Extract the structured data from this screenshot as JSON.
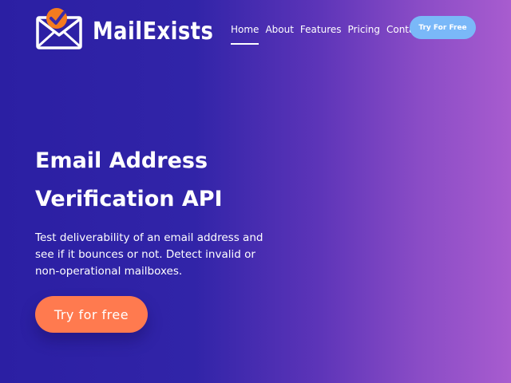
{
  "brand": {
    "name": "MailExists",
    "logo_icon": "envelope-check-icon"
  },
  "nav": {
    "items": [
      {
        "label": "Home",
        "active": true
      },
      {
        "label": "About",
        "active": false
      },
      {
        "label": "Features",
        "active": false
      },
      {
        "label": "Pricing",
        "active": false
      },
      {
        "label": "Contact",
        "active": false
      }
    ],
    "cta_label": "Try For Free"
  },
  "hero": {
    "title_line1": "Email Address",
    "title_line2": "Verification API",
    "description": "Test deliverability of an email address and see if it bounces or not. Detect invalid or non-operational mailboxes.",
    "cta_label": "Try for free"
  },
  "colors": {
    "background_start": "#2b1fa3",
    "background_end": "#a85ccf",
    "header_cta": "#7ab8f8",
    "hero_cta": "#ff7a4f",
    "logo_badge": "#f47b20"
  }
}
